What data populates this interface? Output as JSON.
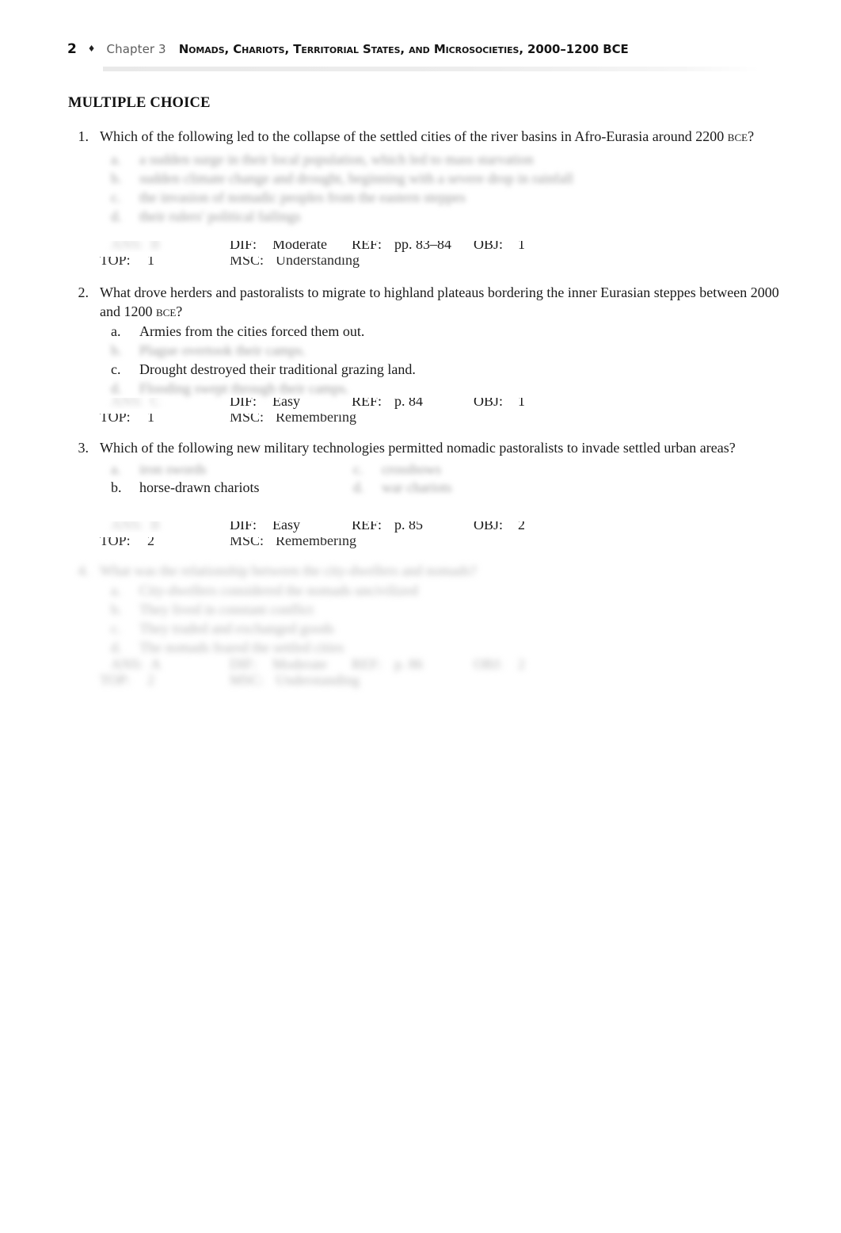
{
  "page": {
    "number": "2",
    "separator": "♦",
    "chapter": "Chapter 3",
    "book_title": "Nomads, Chariots, Territorial States, and Microsocieties, 2000–1200 BCE"
  },
  "section_heading": "MULTIPLE CHOICE",
  "labels": {
    "ans": "ANS:",
    "dif": "DIF:",
    "ref": "REF:",
    "obj": "OBJ:",
    "top": "TOP:",
    "msc": "MSC:"
  },
  "questions": [
    {
      "number": "1.",
      "stem": "Which of the following led to the collapse of the settled cities of the river basins in Afro-Eurasia around 2200 BCE?",
      "stem_visible": true,
      "options": [
        {
          "letter": "a.",
          "text": "a sudden surge in their local population, which led to mass starvation",
          "visible": false
        },
        {
          "letter": "b.",
          "text": "sudden climate change and drought, beginning with a severe drop in rainfall",
          "visible": false
        },
        {
          "letter": "c.",
          "text": "the invasion of nomadic peoples from the eastern steppes",
          "visible": false
        },
        {
          "letter": "d.",
          "text": "their rulers' political failings",
          "visible": false
        }
      ],
      "meta": {
        "ans": "B",
        "ans_visible": false,
        "dif": "Moderate",
        "ref": "pp. 83–84",
        "obj": "1",
        "top": "1",
        "msc": "Understanding"
      }
    },
    {
      "number": "2.",
      "stem": "What drove herders and pastoralists to migrate to highland plateaus bordering the inner Eurasian steppes between 2000 and 1200 BCE?",
      "stem_visible": true,
      "options": [
        {
          "letter": "a.",
          "text": "Armies from the cities forced them out.",
          "visible": true
        },
        {
          "letter": "b.",
          "text": "Plague overtook their camps.",
          "visible": false
        },
        {
          "letter": "c.",
          "text": "Drought destroyed their traditional grazing land.",
          "visible": true
        },
        {
          "letter": "d.",
          "text": "Flooding swept through their camps.",
          "visible": false
        }
      ],
      "meta": {
        "ans": "C",
        "ans_visible": false,
        "dif": "Easy",
        "ref": "p. 84",
        "obj": "1",
        "top": "1",
        "msc": "Remembering"
      }
    },
    {
      "number": "3.",
      "stem": "Which of the following new military technologies permitted nomadic pastoralists to invade settled urban areas?",
      "stem_visible": true,
      "two_column_options": true,
      "options": [
        {
          "letter": "a.",
          "text": "iron swords",
          "visible": false
        },
        {
          "letter": "b.",
          "text": "horse-drawn chariots",
          "visible": true
        },
        {
          "letter": "c.",
          "text": "crossbows",
          "visible": false
        },
        {
          "letter": "d.",
          "text": "war chariots",
          "visible": false
        }
      ],
      "meta": {
        "ans": "B",
        "ans_visible": false,
        "dif": "Easy",
        "ref": "p. 85",
        "obj": "2",
        "top": "2",
        "msc": "Remembering"
      }
    },
    {
      "number": "4.",
      "stem": "What was the relationship between the city-dwellers and nomads?",
      "stem_visible": false,
      "options": [
        {
          "letter": "a.",
          "text": "City-dwellers considered the nomads uncivilized",
          "visible": false
        },
        {
          "letter": "b.",
          "text": "They lived in constant conflict",
          "visible": false
        },
        {
          "letter": "c.",
          "text": "They traded and exchanged goods",
          "visible": false
        },
        {
          "letter": "d.",
          "text": "The nomads feared the settled cities",
          "visible": false
        }
      ],
      "meta": {
        "ans": "A",
        "ans_visible": false,
        "dif": "Moderate",
        "ref": "p. 86",
        "obj": "2",
        "top": "2",
        "msc": "Understanding"
      }
    }
  ]
}
